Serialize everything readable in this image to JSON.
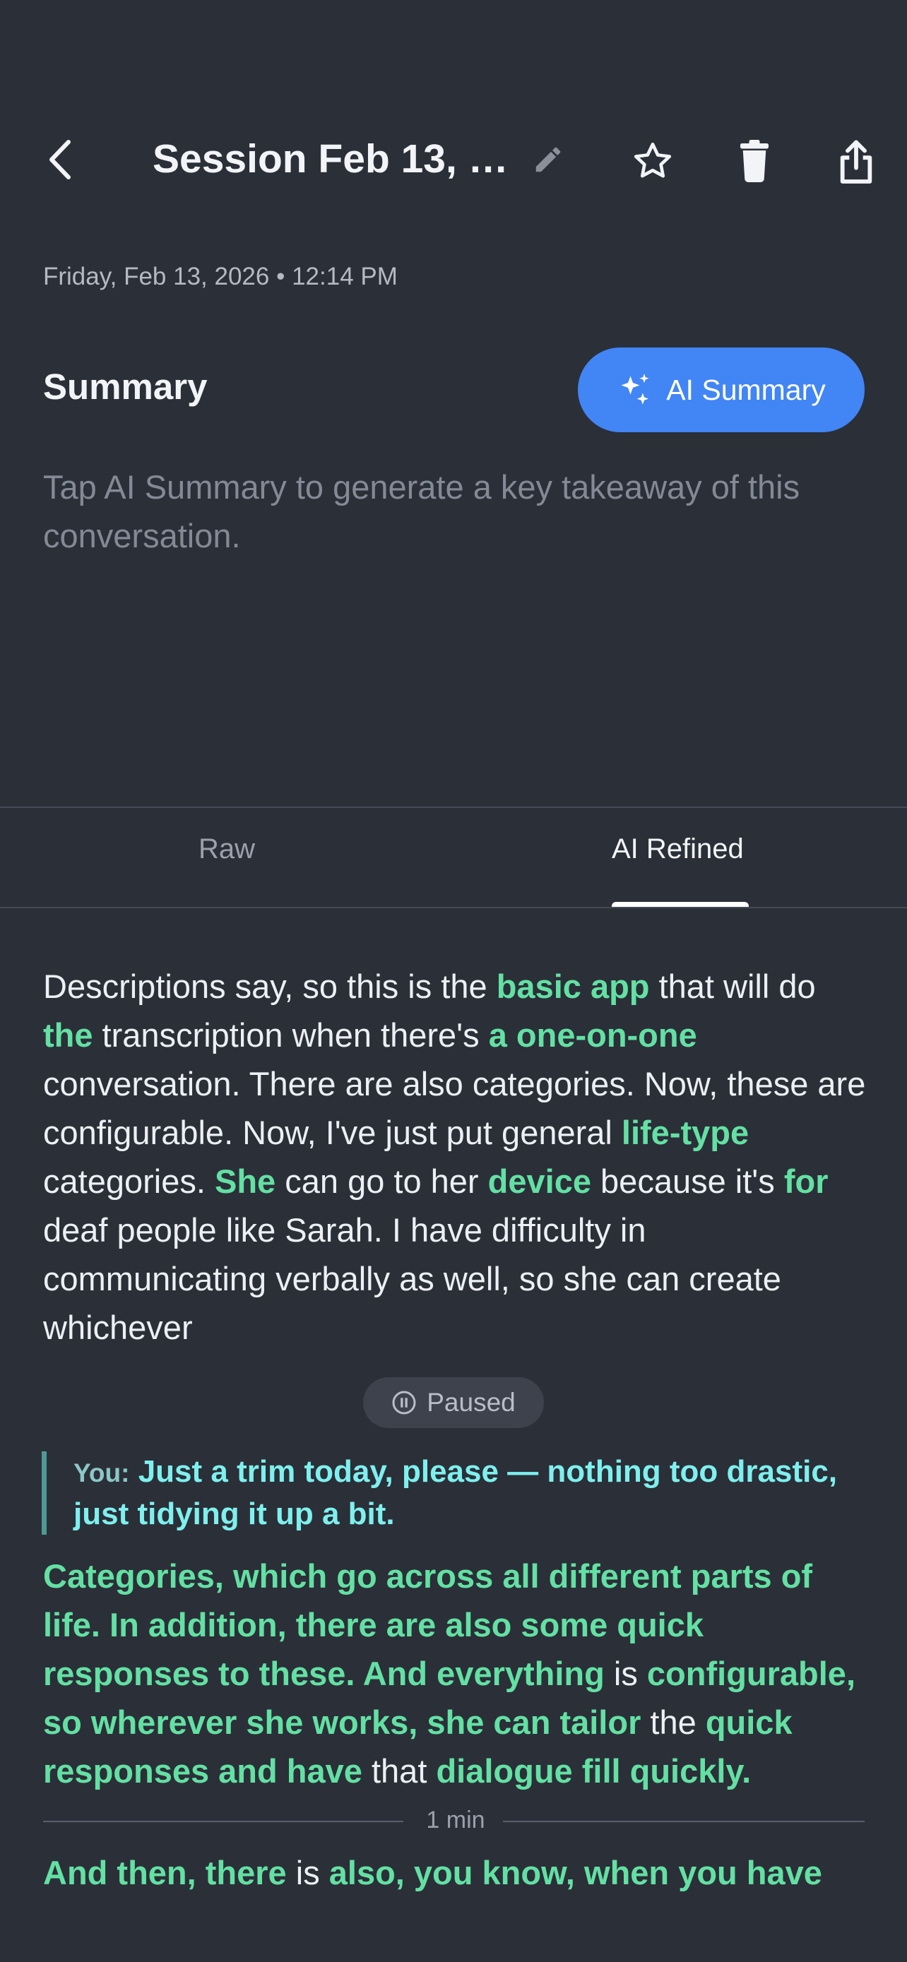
{
  "header": {
    "title": "Session Feb 13, …",
    "icons": [
      "back-icon",
      "edit-icon",
      "star-icon",
      "trash-icon",
      "share-icon"
    ]
  },
  "date": "Friday, Feb 13, 2026 • 12:14 PM",
  "summary": {
    "label": "Summary",
    "button_label": "AI Summary",
    "hint": "Tap AI Summary to generate a key takeaway of this conversation."
  },
  "tabs": {
    "raw": "Raw",
    "refined": "AI Refined",
    "active": "AI Refined"
  },
  "transcript": {
    "segment1": [
      {
        "t": "Descriptions say, so this is the ",
        "h": false
      },
      {
        "t": "basic app",
        "h": true
      },
      {
        "t": " that will do ",
        "h": false
      },
      {
        "t": "the",
        "h": true
      },
      {
        "t": " transcription when there's ",
        "h": false
      },
      {
        "t": "a one-on-one",
        "h": true
      },
      {
        "t": " conversation. There are also categories. Now, these are configurable. Now, I've just put general ",
        "h": false
      },
      {
        "t": "life-type",
        "h": true
      },
      {
        "t": " categories. ",
        "h": false
      },
      {
        "t": "She",
        "h": true
      },
      {
        "t": " can go to her ",
        "h": false
      },
      {
        "t": "device",
        "h": true
      },
      {
        "t": " because it's ",
        "h": false
      },
      {
        "t": "for",
        "h": true
      },
      {
        "t": " deaf people like Sarah. I have difficulty in communicating verbally as well, so she can create whichever",
        "h": false
      }
    ],
    "paused_label": "Paused",
    "you_label": "You:",
    "you_text": "Just a trim today, please — nothing too drastic, just tidying it up a bit.",
    "segment2": [
      {
        "t": "Categories, which go across all different parts of life. In addition, there are also some quick responses to these. And everything",
        "h": true
      },
      {
        "t": " is ",
        "h": false
      },
      {
        "t": "configurable, so wherever she works, she can tailor",
        "h": true
      },
      {
        "t": " the ",
        "h": false
      },
      {
        "t": "quick responses and have",
        "h": true
      },
      {
        "t": " that ",
        "h": false
      },
      {
        "t": "dialogue fill quickly.",
        "h": true
      }
    ],
    "divider_label": "1 min",
    "segment3": [
      {
        "t": "And then, there",
        "h": true
      },
      {
        "t": " is ",
        "h": false
      },
      {
        "t": "also, you know, when you have",
        "h": true
      }
    ]
  },
  "colors": {
    "background": "#2b2f38",
    "accent": "#4285f4",
    "highlight": "#63e0a3",
    "you_text": "#7ef0ee"
  }
}
